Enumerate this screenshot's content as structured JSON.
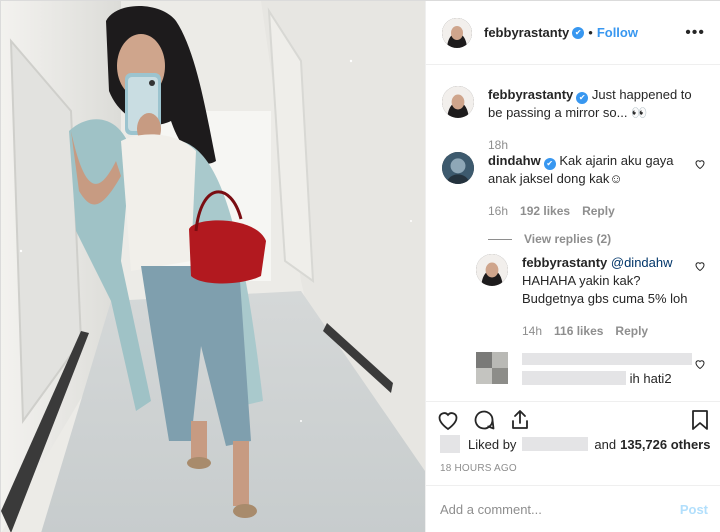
{
  "post": {
    "username": "febbyrastanty",
    "verified_icon": "verified-badge-icon",
    "follow_label": "Follow",
    "separator": "•",
    "more_label": "•••"
  },
  "caption": {
    "username": "febbyrastanty",
    "text": "Just happened to be passing a mirror so... 👀",
    "time": "18h"
  },
  "comments": [
    {
      "username": "dindahw",
      "text": "Kak ajarin aku gaya anak jaksel dong kak☺",
      "time": "16h",
      "likes": "192 likes",
      "reply_label": "Reply",
      "view_replies": "View replies (2)"
    }
  ],
  "reply": {
    "username": "febbyrastanty",
    "mention": "@dindahw",
    "text": "HAHAHA yakin kak? Budgetnya gbs cuma 5% loh",
    "time": "14h",
    "likes": "116 likes",
    "reply_label": "Reply"
  },
  "partial_reply": {
    "text_tail": "ih hati2"
  },
  "likes_bar": {
    "prefix": "Liked by",
    "and_label": "and",
    "count": "135,726 others"
  },
  "timestamp": "18 HOURS AGO",
  "comment_box": {
    "placeholder": "Add a comment...",
    "post_label": "Post"
  },
  "colors": {
    "accent": "#3897f0",
    "post_disabled": "#b2dffc",
    "muted": "#8e8e8e"
  }
}
